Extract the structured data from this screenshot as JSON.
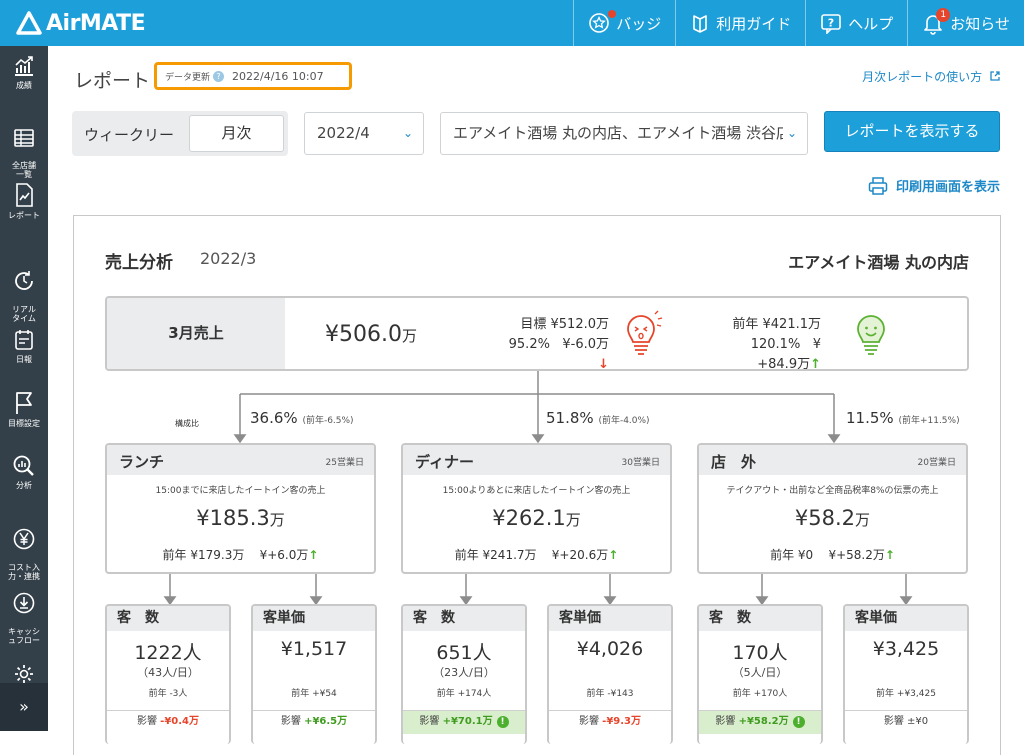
{
  "app": {
    "logo": "AirMATE"
  },
  "topnav": [
    {
      "label": "バッジ",
      "icon": "badge-icon"
    },
    {
      "label": "利用ガイド",
      "icon": "guide-book-icon"
    },
    {
      "label": "ヘルプ",
      "icon": "help-icon"
    },
    {
      "label": "お知らせ",
      "icon": "bell-icon",
      "count": "1"
    }
  ],
  "sidebar": [
    {
      "label": "成績",
      "icon": "chart-up-icon"
    },
    {
      "label": "全店舗\n一覧",
      "icon": "table-icon"
    },
    {
      "label": "レポート",
      "icon": "report-icon"
    },
    {
      "label": "リアル\nタイム",
      "icon": "clock-icon"
    },
    {
      "label": "日報",
      "icon": "daily-note-icon"
    },
    {
      "label": "目標設定",
      "icon": "flag-icon"
    },
    {
      "label": "分析",
      "icon": "magnifier-chart-icon"
    },
    {
      "label": "コスト入\n力・連携",
      "icon": "yen-icon"
    },
    {
      "label": "キャッシ\nュフロー",
      "icon": "cashflow-icon"
    }
  ],
  "page": {
    "title": "レポート",
    "update_label": "データ更新",
    "update_time": "2022/4/16 10:07",
    "guide_link": "月次レポートの使い方",
    "period_weekly": "ウィークリー",
    "period_monthly": "月次",
    "month_value": "2022/4",
    "store_value": "エアメイト酒場 丸の内店、エアメイト酒場 渋谷店",
    "show_button": "レポートを表示する",
    "print_link": "印刷用画面を表示"
  },
  "report": {
    "title": "売上分析",
    "period": "2022/3",
    "store": "エアメイト酒場 丸の内店",
    "summary": {
      "label": "3月売上",
      "value": "¥506.0",
      "unit": "万",
      "target_line1": "目標 ¥512.0万",
      "target_rate": "95.2%",
      "target_diff": "¥-6.0万",
      "prev_line1": "前年 ¥421.1万",
      "prev_rate": "120.1%",
      "prev_diff": "¥+84.9万"
    },
    "composition_label": "構成比",
    "segments": [
      {
        "pct": "36.6%",
        "pct_note": "(前年-6.5%)",
        "name": "ランチ",
        "days": "25営業日",
        "desc": "15:00までに来店したイートイン客の売上",
        "value": "¥185.3",
        "unit": "万",
        "prev": "前年 ¥179.3万",
        "diff": "¥+6.0万"
      },
      {
        "pct": "51.8%",
        "pct_note": "(前年-4.0%)",
        "name": "ディナー",
        "days": "30営業日",
        "desc": "15:00よりあとに来店したイートイン客の売上",
        "value": "¥262.1",
        "unit": "万",
        "prev": "前年 ¥241.7万",
        "diff": "¥+20.6万"
      },
      {
        "pct": "11.5%",
        "pct_note": "(前年+11.5%)",
        "name": "店　外",
        "days": "20営業日",
        "desc": "テイクアウト・出前など全商品税率8%の伝票の売上",
        "value": "¥58.2",
        "unit": "万",
        "prev": "前年 ¥0",
        "diff": "¥+58.2万"
      }
    ],
    "metrics": [
      {
        "name": "客　数",
        "value": "1222人",
        "sub": "（43人/日）",
        "prev": "前年 -3人",
        "impact_label": "影響",
        "impact": "-¥0.4万",
        "tone": "neg",
        "highlight": false
      },
      {
        "name": "客単価",
        "value": "¥1,517",
        "sub": "",
        "prev": "前年 +¥54",
        "impact_label": "影響",
        "impact": "+¥6.5万",
        "tone": "pos",
        "highlight": false
      },
      {
        "name": "客　数",
        "value": "651人",
        "sub": "（23人/日）",
        "prev": "前年 +174人",
        "impact_label": "影響",
        "impact": "+¥70.1万",
        "tone": "pos",
        "highlight": true
      },
      {
        "name": "客単価",
        "value": "¥4,026",
        "sub": "",
        "prev": "前年 -¥143",
        "impact_label": "影響",
        "impact": "-¥9.3万",
        "tone": "neg",
        "highlight": false
      },
      {
        "name": "客　数",
        "value": "170人",
        "sub": "（5人/日）",
        "prev": "前年 +170人",
        "impact_label": "影響",
        "impact": "+¥58.2万",
        "tone": "pos",
        "highlight": true
      },
      {
        "name": "客単価",
        "value": "¥3,425",
        "sub": "",
        "prev": "前年 +¥3,425",
        "impact_label": "影響",
        "impact": "±¥0",
        "tone": "zero",
        "highlight": false
      }
    ]
  }
}
